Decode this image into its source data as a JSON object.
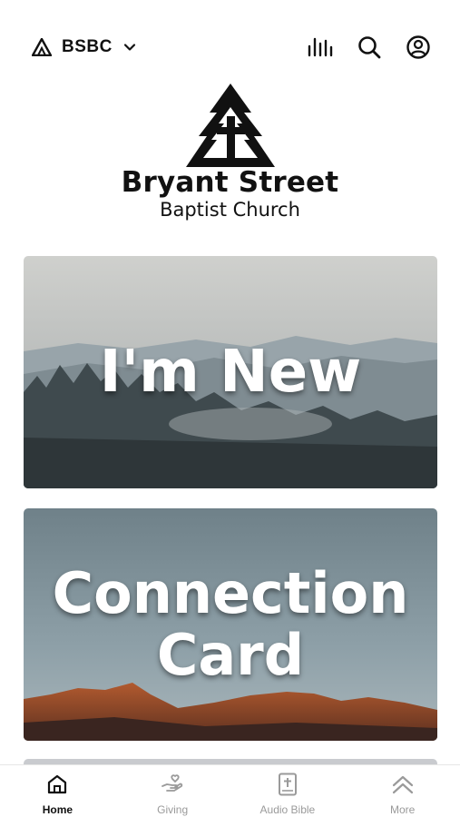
{
  "header": {
    "org_name": "BSBC",
    "icons": [
      "org-logo-icon",
      "chevron-down-icon",
      "audio-bars-icon",
      "search-icon",
      "account-icon"
    ]
  },
  "church": {
    "name": "Bryant Street",
    "subtitle": "Baptist Church"
  },
  "cards": [
    {
      "title": "I'm New"
    },
    {
      "title": "Connection Card"
    }
  ],
  "bottom_nav": {
    "items": [
      {
        "label": "Home",
        "icon": "home-icon",
        "active": true
      },
      {
        "label": "Giving",
        "icon": "giving-hand-icon",
        "active": false
      },
      {
        "label": "Audio Bible",
        "icon": "bible-icon",
        "active": false
      },
      {
        "label": "More",
        "icon": "chevrons-up-icon",
        "active": false
      }
    ]
  },
  "colors": {
    "active": "#111111",
    "inactive": "#9a9a9a"
  }
}
